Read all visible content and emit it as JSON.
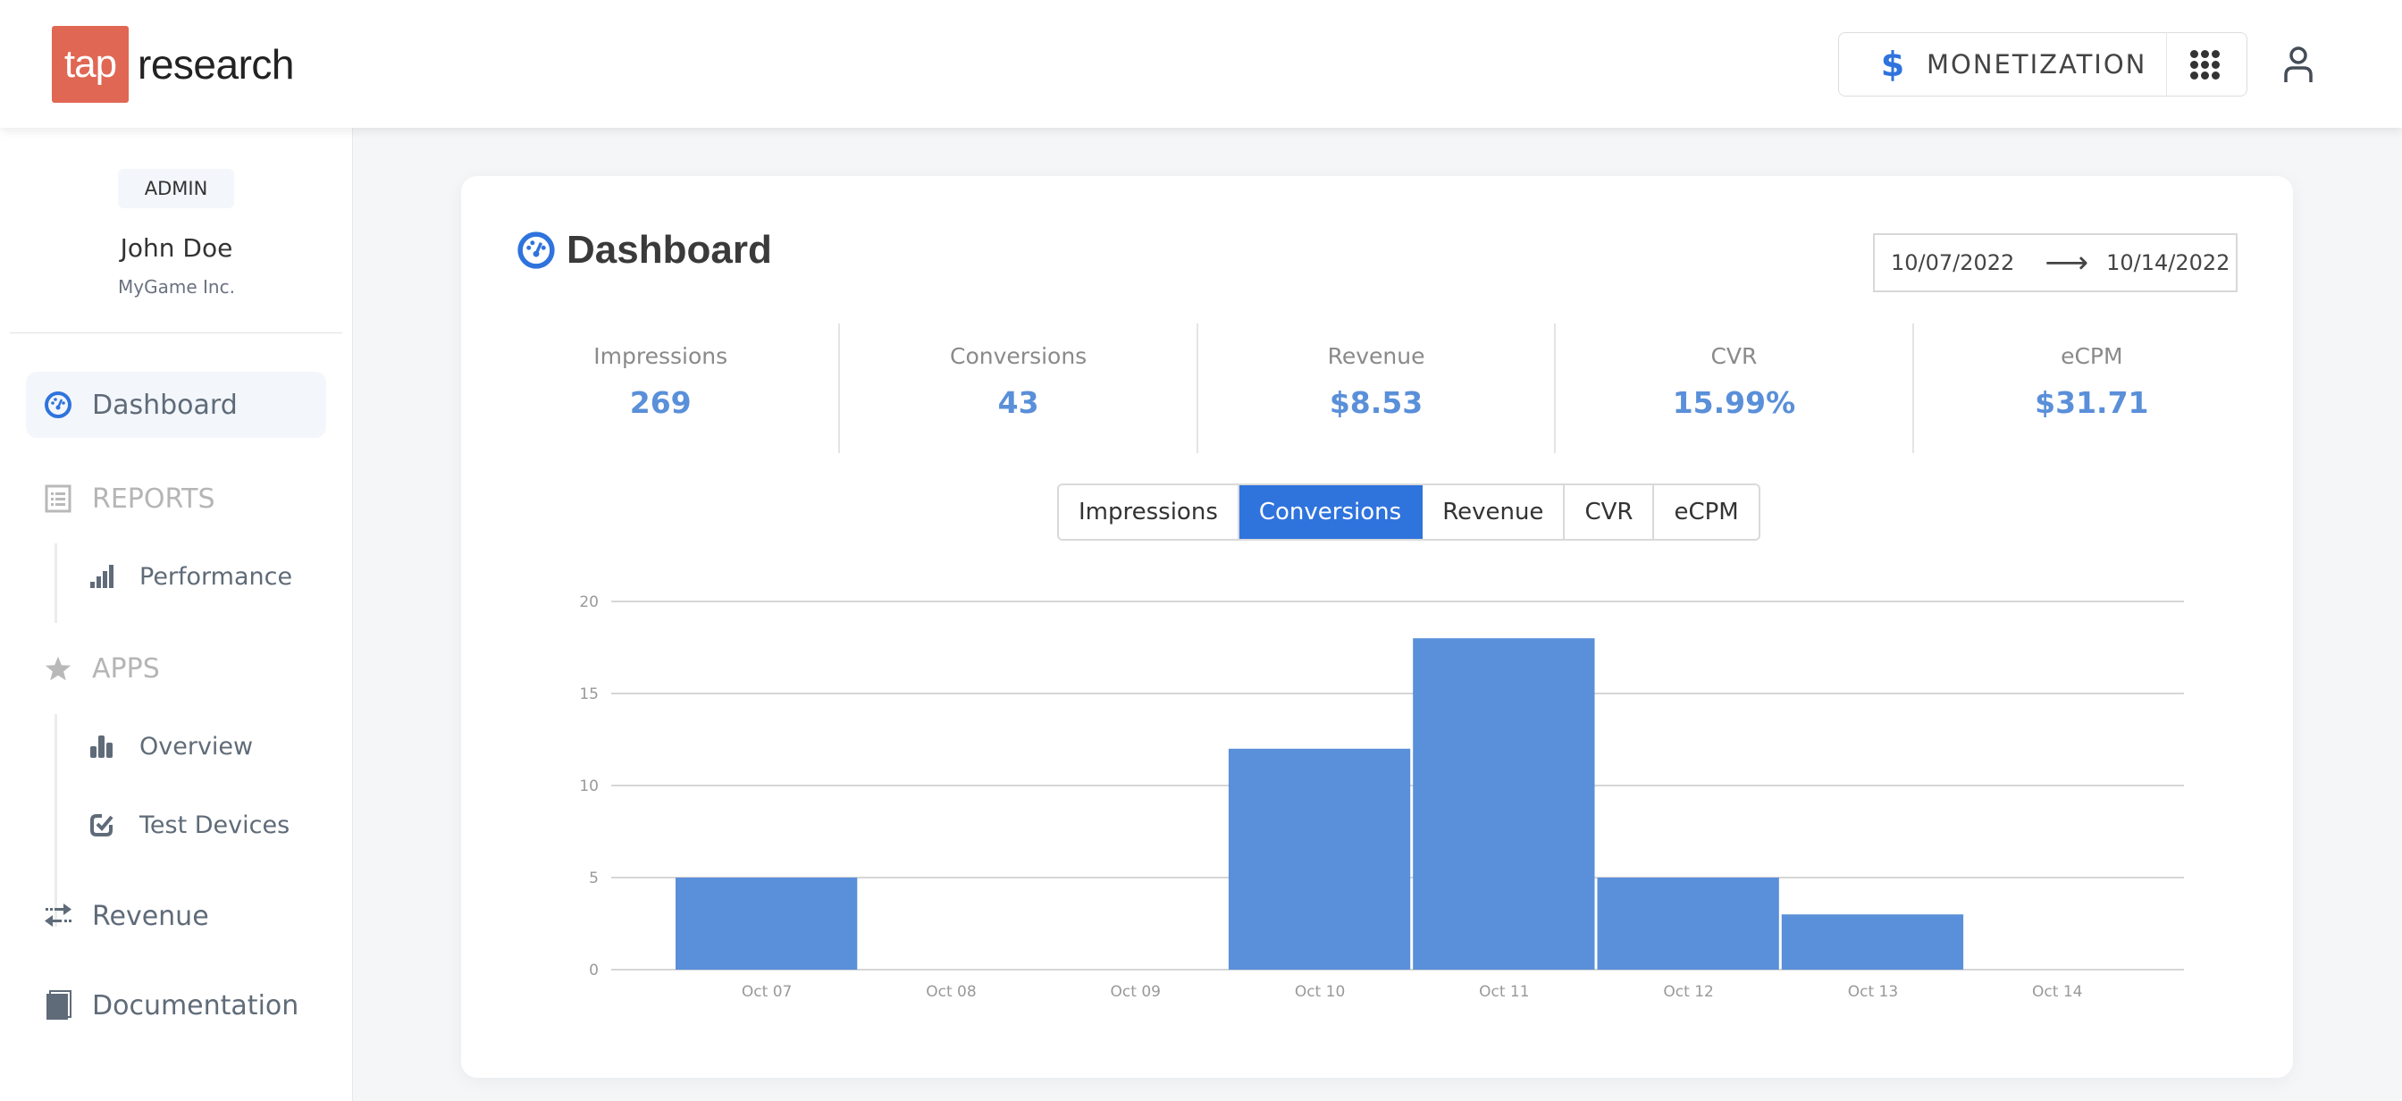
{
  "header": {
    "logo_tap": "tap",
    "logo_word": "research",
    "product_icon": "dollar-icon",
    "product_label": "MONETIZATION",
    "apps_icon": "grid-icon",
    "account_icon": "user-icon"
  },
  "sidebar": {
    "role": "ADMIN",
    "user_name": "John Doe",
    "org": "MyGame Inc.",
    "items": [
      {
        "label": "Dashboard",
        "icon": "dashboard-gauge-icon",
        "active": true
      },
      {
        "label": "REPORTS",
        "icon": "list-icon",
        "section": true,
        "children": [
          {
            "label": "Performance",
            "icon": "signal-bars-icon"
          }
        ]
      },
      {
        "label": "APPS",
        "icon": "star-icon",
        "section": true,
        "children": [
          {
            "label": "Overview",
            "icon": "bar-chart-icon"
          },
          {
            "label": "Test Devices",
            "icon": "checkbox-icon"
          }
        ]
      },
      {
        "label": "Revenue",
        "icon": "exchange-arrows-icon"
      },
      {
        "label": "Documentation",
        "icon": "book-icon"
      }
    ]
  },
  "main": {
    "title": "Dashboard",
    "date_from": "10/07/2022",
    "date_arrow": "⟶",
    "date_to": "10/14/2022",
    "stats": [
      {
        "label": "Impressions",
        "value": "269"
      },
      {
        "label": "Conversions",
        "value": "43"
      },
      {
        "label": "Revenue",
        "value": "$8.53"
      },
      {
        "label": "CVR",
        "value": "15.99%"
      },
      {
        "label": "eCPM",
        "value": "$31.71"
      }
    ],
    "metric_tabs": [
      "Impressions",
      "Conversions",
      "Revenue",
      "CVR",
      "eCPM"
    ],
    "active_tab": "Conversions"
  },
  "colors": {
    "accent": "#2f73dd",
    "bar": "#5a8fd9",
    "logo": "#e06753",
    "stat_value": "#5a8fd9"
  },
  "chart_data": {
    "type": "bar",
    "title": "",
    "xlabel": "",
    "ylabel": "",
    "series_name": "Conversions",
    "categories": [
      "Oct 07",
      "Oct 08",
      "Oct 09",
      "Oct 10",
      "Oct 11",
      "Oct 12",
      "Oct 13",
      "Oct 14"
    ],
    "values": [
      5,
      0,
      0,
      12,
      18,
      5,
      3,
      0
    ],
    "ylim": [
      0,
      20
    ],
    "yticks": [
      0,
      5,
      10,
      15,
      20
    ],
    "grid": true,
    "legend": "none"
  }
}
